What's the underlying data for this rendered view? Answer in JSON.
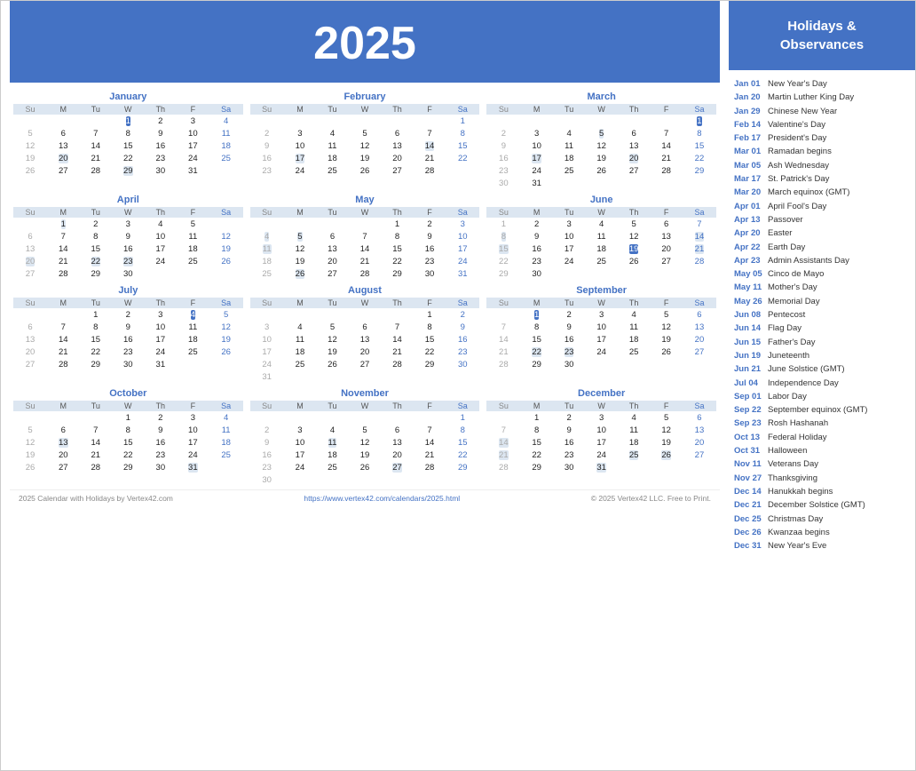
{
  "year": "2025",
  "sidebar_title": "Holidays &\nObservances",
  "holidays": [
    {
      "date": "Jan 01",
      "name": "New Year's Day"
    },
    {
      "date": "Jan 20",
      "name": "Martin Luther King Day"
    },
    {
      "date": "Jan 29",
      "name": "Chinese New Year"
    },
    {
      "date": "Feb 14",
      "name": "Valentine's Day"
    },
    {
      "date": "Feb 17",
      "name": "President's Day"
    },
    {
      "date": "Mar 01",
      "name": "Ramadan begins"
    },
    {
      "date": "Mar 05",
      "name": "Ash Wednesday"
    },
    {
      "date": "Mar 17",
      "name": "St. Patrick's Day"
    },
    {
      "date": "Mar 20",
      "name": "March equinox (GMT)"
    },
    {
      "date": "Apr 01",
      "name": "April Fool's Day"
    },
    {
      "date": "Apr 13",
      "name": "Passover"
    },
    {
      "date": "Apr 20",
      "name": "Easter"
    },
    {
      "date": "Apr 22",
      "name": "Earth Day"
    },
    {
      "date": "Apr 23",
      "name": "Admin Assistants Day"
    },
    {
      "date": "May 05",
      "name": "Cinco de Mayo"
    },
    {
      "date": "May 11",
      "name": "Mother's Day"
    },
    {
      "date": "May 26",
      "name": "Memorial Day"
    },
    {
      "date": "Jun 08",
      "name": "Pentecost"
    },
    {
      "date": "Jun 14",
      "name": "Flag Day"
    },
    {
      "date": "Jun 15",
      "name": "Father's Day"
    },
    {
      "date": "Jun 19",
      "name": "Juneteenth"
    },
    {
      "date": "Jun 21",
      "name": "June Solstice (GMT)"
    },
    {
      "date": "Jul 04",
      "name": "Independence Day"
    },
    {
      "date": "Sep 01",
      "name": "Labor Day"
    },
    {
      "date": "Sep 22",
      "name": "September equinox (GMT)"
    },
    {
      "date": "Sep 23",
      "name": "Rosh Hashanah"
    },
    {
      "date": "Oct 13",
      "name": "Federal Holiday"
    },
    {
      "date": "Oct 31",
      "name": "Halloween"
    },
    {
      "date": "Nov 11",
      "name": "Veterans Day"
    },
    {
      "date": "Nov 27",
      "name": "Thanksgiving"
    },
    {
      "date": "Dec 14",
      "name": "Hanukkah begins"
    },
    {
      "date": "Dec 21",
      "name": "December Solstice (GMT)"
    },
    {
      "date": "Dec 25",
      "name": "Christmas Day"
    },
    {
      "date": "Dec 26",
      "name": "Kwanzaa begins"
    },
    {
      "date": "Dec 31",
      "name": "New Year's Eve"
    }
  ],
  "footer_left": "2025 Calendar with Holidays by Vertex42.com",
  "footer_url": "https://www.vertex42.com/calendars/2025.html",
  "footer_right": "© 2025 Vertex42 LLC. Free to Print."
}
